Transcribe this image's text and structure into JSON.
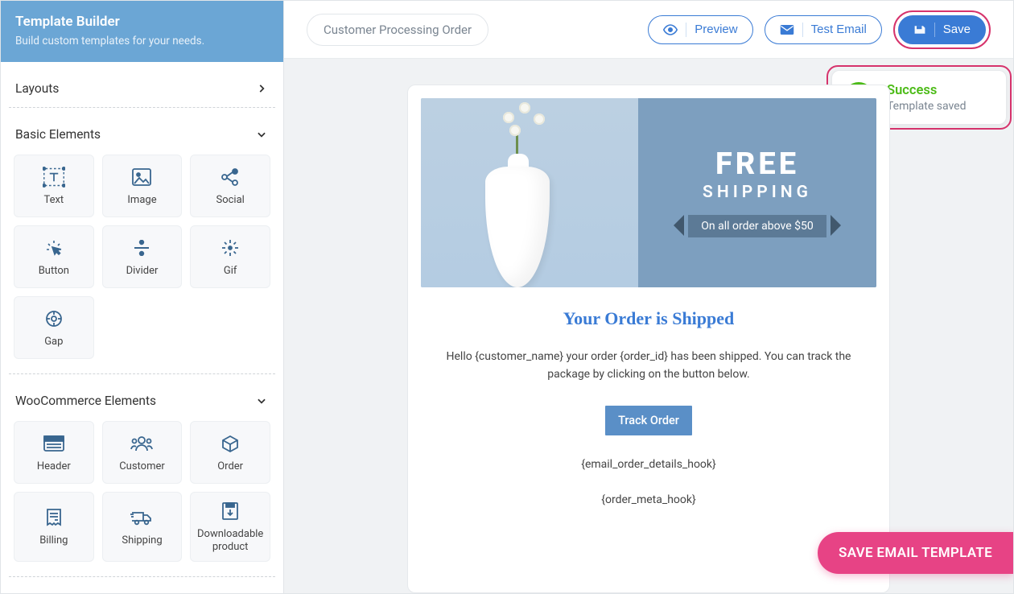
{
  "sidebar": {
    "title": "Template Builder",
    "subtitle": "Build custom templates for your needs.",
    "sections": {
      "layouts": {
        "label": "Layouts"
      },
      "basic": {
        "label": "Basic Elements",
        "tiles": [
          "Text",
          "Image",
          "Social",
          "Button",
          "Divider",
          "Gif",
          "Gap"
        ]
      },
      "woo": {
        "label": "WooCommerce Elements",
        "tiles": [
          "Header",
          "Customer",
          "Order",
          "Billing",
          "Shipping",
          "Downloadable product"
        ]
      }
    }
  },
  "topbar": {
    "templateName": "Customer Processing Order",
    "preview": "Preview",
    "testEmail": "Test Email",
    "save": "Save"
  },
  "toast": {
    "title": "Success",
    "message": "Template saved"
  },
  "email": {
    "hero_line1": "FREE",
    "hero_line2": "SHIPPING",
    "hero_ribbon": "On all order above $50",
    "heading": "Your Order is Shipped",
    "body": "Hello {customer_name} your order {order_id} has been shipped. You can track the package by clicking on the button below.",
    "cta": "Track Order",
    "hook1": "{email_order_details_hook}",
    "hook2": "{order_meta_hook}"
  },
  "fab": "SAVE EMAIL TEMPLATE"
}
